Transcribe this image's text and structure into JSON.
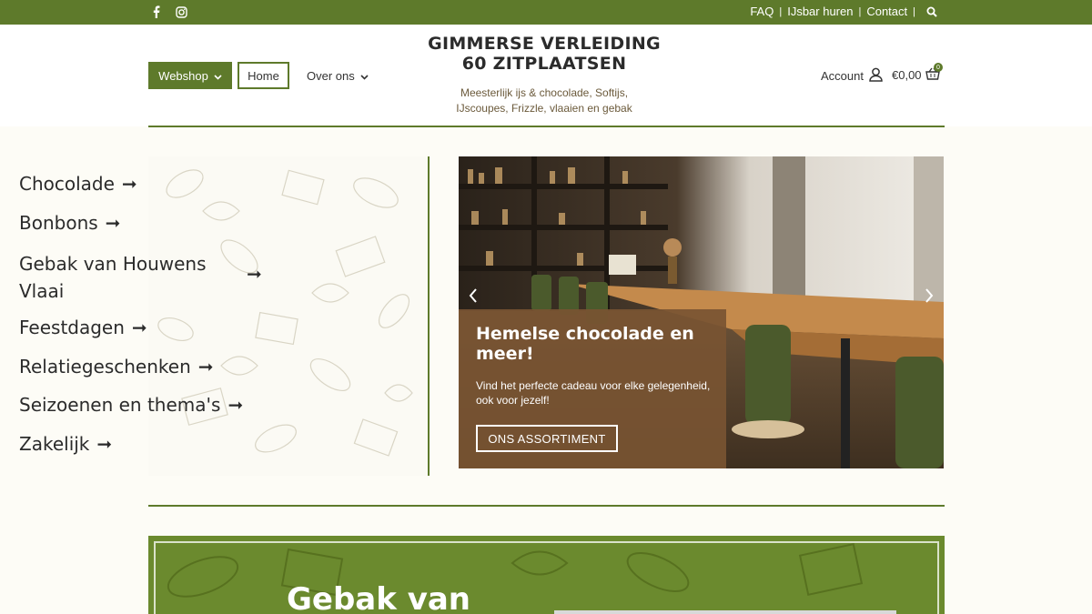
{
  "topbar": {
    "social": [
      "facebook-icon",
      "instagram-icon"
    ],
    "links": [
      "FAQ",
      "IJsbar huren",
      "Contact"
    ],
    "separator": "|"
  },
  "header": {
    "nav": {
      "webshop": "Webshop",
      "home": "Home",
      "over_ons": "Over ons"
    },
    "brand_line1": "GIMMERSE VERLEIDING",
    "brand_line2": "60 ZITPLAATSEN",
    "tagline_line1": "Meesterlijk ijs & chocolade, Softijs,",
    "tagline_line2": "IJscoupes, Frizzle, vlaaien en gebak",
    "account": "Account",
    "cart_total": "€0,00",
    "cart_count": "0"
  },
  "categories": [
    {
      "label": "Chocolade"
    },
    {
      "label": "Bonbons"
    },
    {
      "label_line1": "Gebak van Houwens",
      "label_line2": "Vlaai"
    },
    {
      "label": "Feestdagen"
    },
    {
      "label": "Relatiegeschenken"
    },
    {
      "label": "Seizoenen en thema's"
    },
    {
      "label": "Zakelijk"
    }
  ],
  "arrow": "➞",
  "slider": {
    "title": "Hemelse chocolade en meer!",
    "text": "Vind het perfecte cadeau voor elke gelegenheid, ook voor jezelf!",
    "button": "ONS ASSORTIMENT"
  },
  "promo": {
    "title": "Gebak van"
  },
  "colors": {
    "brand_green": "#5e7a2b",
    "overlay_brown": "#785432",
    "background": "#fdfcf6"
  }
}
